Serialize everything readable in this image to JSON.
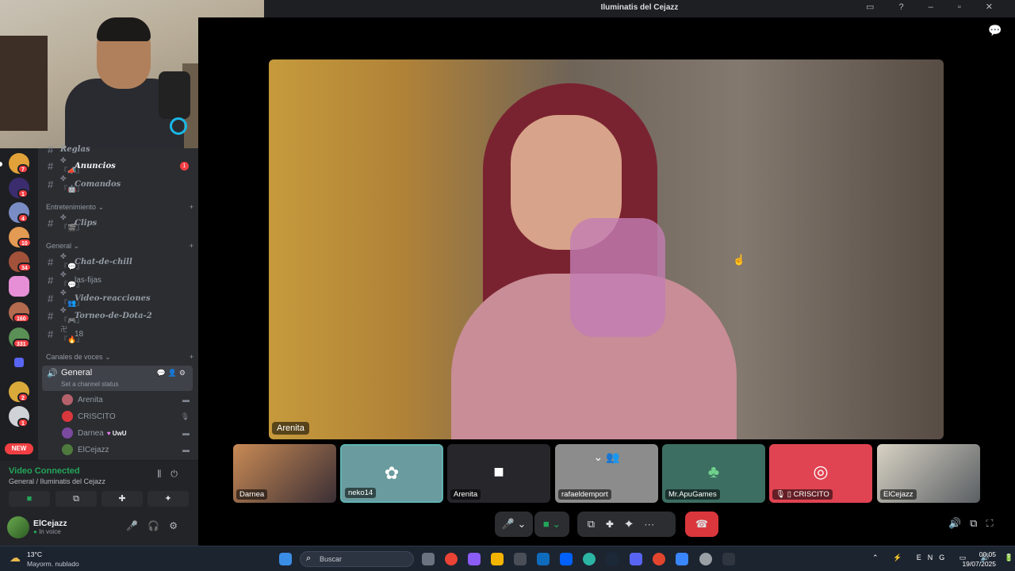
{
  "window": {
    "title": "Iluminatis del Cejazz"
  },
  "servers": [
    {
      "badge": "7"
    },
    {
      "badge": "1"
    },
    {
      "badge": "4"
    },
    {
      "badge": "10"
    },
    {
      "badge": "34"
    },
    {
      "badge": ""
    },
    {
      "badge": "160"
    },
    {
      "badge": "331"
    },
    {
      "badge": ""
    },
    {
      "badge": "2"
    },
    {
      "badge": "1"
    }
  ],
  "new_label": "NEW",
  "channels": {
    "top_partial": "Reglas",
    "items": [
      {
        "deco": "✤『📣』",
        "name": "Anuncios",
        "badge": "1"
      },
      {
        "deco": "✤『🤖』",
        "name": "Comandos"
      }
    ],
    "cat_entertainment": "Entretenimiento",
    "entertainment": [
      {
        "deco": "✤『🎬』",
        "name": "Clips"
      }
    ],
    "cat_general": "General",
    "general": [
      {
        "deco": "✤『💬』",
        "name": "Chat-de-chill"
      },
      {
        "deco": "✤『💬』",
        "name": "las-fijas"
      },
      {
        "deco": "✤『👥』",
        "name": "Video-reacciones"
      },
      {
        "deco": "✤『🎮』",
        "name": "Torneo-de-Dota-2"
      },
      {
        "deco": "卍『🔥』",
        "name": "18"
      }
    ],
    "cat_voice": "Canales de voces",
    "voice_channel": {
      "name": "General",
      "status": "Set a channel status"
    },
    "voice_users": [
      {
        "name": "Arenita"
      },
      {
        "name": "CRISCITO"
      },
      {
        "name": "Darnea",
        "tag": "UwU"
      },
      {
        "name": "ElCejazz"
      }
    ]
  },
  "voice_connected": {
    "label": "Video Connected",
    "sub": "General / Iluminatis del Cejazz"
  },
  "user": {
    "name": "ElCejazz",
    "status": "In voice"
  },
  "main_video": {
    "label": "Arenita"
  },
  "tiles": [
    {
      "name": "Darnea"
    },
    {
      "name": "neko14"
    },
    {
      "name": "Arenita"
    },
    {
      "name": "rafaeldemport"
    },
    {
      "name": "Mr.ApuGames"
    },
    {
      "name": "CRISCITO"
    },
    {
      "name": "ElCejazz"
    }
  ],
  "taskbar": {
    "temp": "13°C",
    "weather": "Mayorm. nublado",
    "search_placeholder": "Buscar",
    "lang": "ENG",
    "time": "00:05",
    "date": "19/07/2025"
  },
  "colors": {
    "accent": "#5865f2",
    "green": "#23a55a",
    "red": "#da373c"
  }
}
